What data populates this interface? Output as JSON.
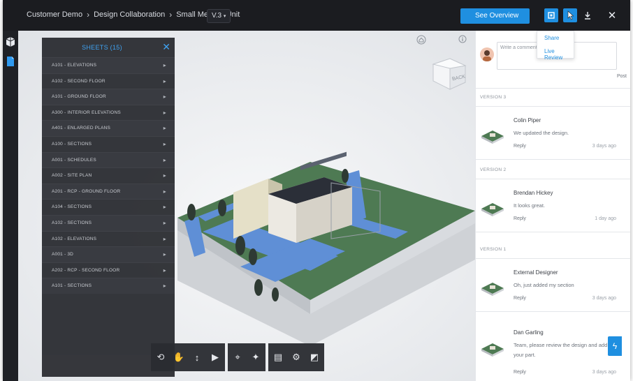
{
  "header": {
    "breadcrumb": [
      "Customer Demo",
      "Design Collaboration",
      "Small Medical Unit"
    ],
    "version": "V.3",
    "see_overview": "See Overview"
  },
  "dropdown": {
    "items": [
      "Share",
      "Live Review"
    ]
  },
  "sheets": {
    "title": "SHEETS (15)",
    "items": [
      "A101 - ELEVATIONS",
      "A102 - SECOND FLOOR",
      "A101 - GROUND FLOOR",
      "A300 - INTERIOR ELEVATIONS",
      "A401 - ENLARGED PLANS",
      "A100 - SECTIONS",
      "A001 - SCHEDULES",
      "A002 - SITE PLAN",
      "A201 - RCP - GROUND FLOOR",
      "A104 - SECTIONS",
      "A102 - SECTIONS",
      "A102 - ELEVATIONS",
      "A001 - 3D",
      "A202 - RCP - SECOND FLOOR",
      "A101 - SECTIONS"
    ]
  },
  "viewcube": {
    "face": "BACK"
  },
  "panel": {
    "placeholder": "Write a comment...",
    "post": "Post",
    "groups": [
      {
        "version": "VERSION 3",
        "author": "Colin Piper",
        "text": "We updated the design.",
        "reply": "Reply",
        "time": "3 days ago"
      },
      {
        "version": "VERSION 2",
        "author": "Brendan Hickey",
        "text": "It looks great.",
        "reply": "Reply",
        "time": "1 day ago"
      },
      {
        "version": "VERSION 1",
        "author": "External Designer",
        "text": "Oh, just added my section",
        "reply": "Reply",
        "time": "3 days ago"
      }
    ],
    "last": {
      "author": "Dan Garling",
      "text": "Team, please review the design and add",
      "text2": "your part.",
      "reply": "Reply",
      "time": "3 days ago"
    }
  },
  "colors": {
    "accent": "#1f8fe0",
    "topbar": "#1b1c20",
    "sheets_bg": "#2f3136"
  }
}
